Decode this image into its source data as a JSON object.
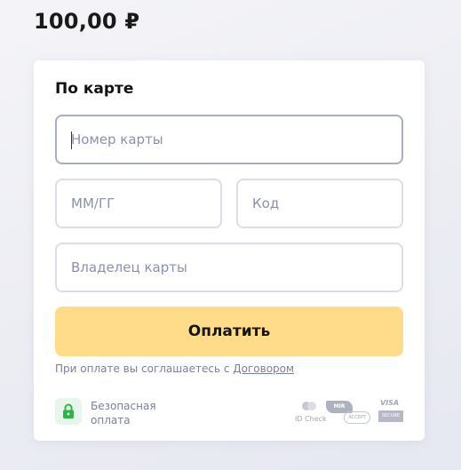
{
  "amount": "100,00 ₽",
  "form": {
    "title": "По карте",
    "card_number_placeholder": "Номер карты",
    "expiry_placeholder": "ММ/ГГ",
    "cvc_placeholder": "Код",
    "holder_placeholder": "Владелец карты",
    "pay_button": "Оплатить",
    "agreement_prefix": "При оплате вы соглашаетесь с ",
    "agreement_link": "Договором",
    "secure_label": "Безопасная оплата"
  },
  "payment_logos": {
    "id_check": "ID Check",
    "mir": "MIR",
    "mir_accept": "ACCEPT",
    "visa": "VISA",
    "visa_secure": "SECURE"
  },
  "icons": {
    "lock": "lock-icon"
  },
  "colors": {
    "pay_button": "#ffdc8a",
    "field_border": "#dcdee7",
    "field_border_focused": "#a9aec3",
    "secure_green": "#2fb24a"
  }
}
